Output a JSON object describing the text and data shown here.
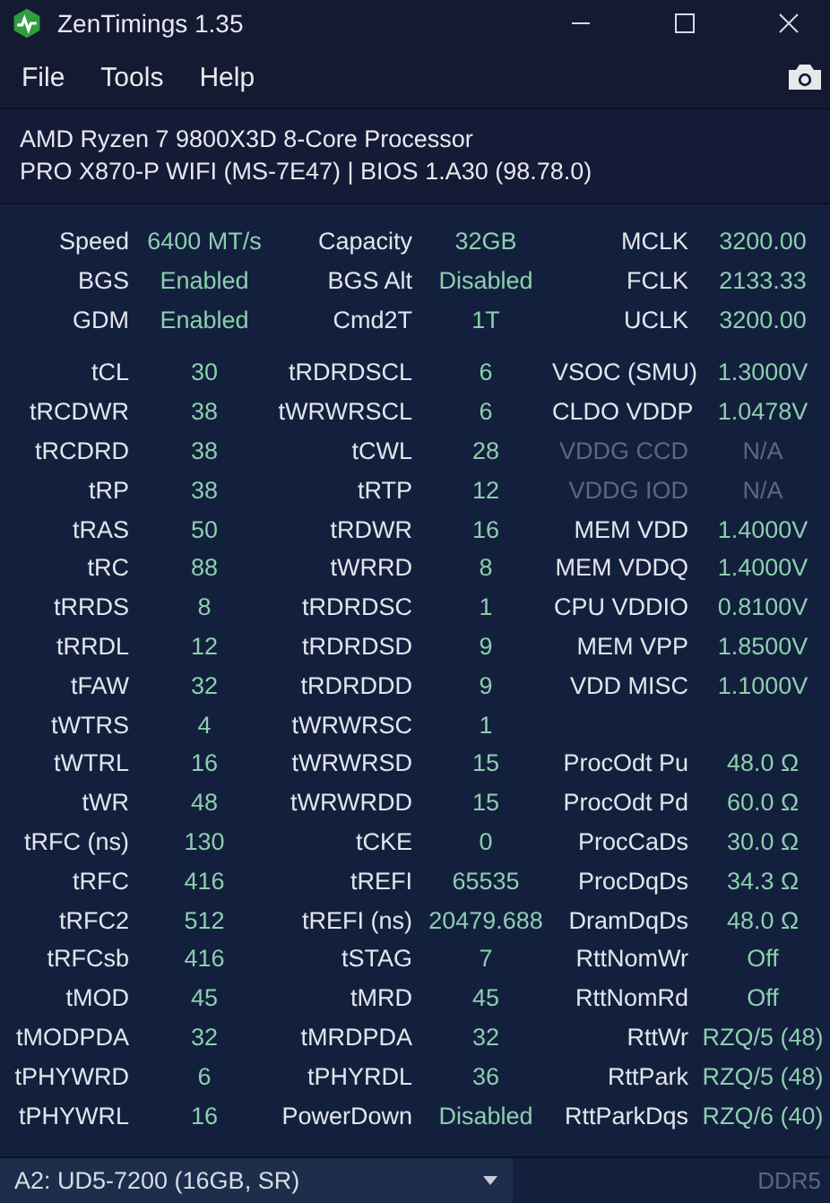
{
  "window": {
    "title": "ZenTimings 1.35"
  },
  "menu": [
    {
      "label": "File"
    },
    {
      "label": "Tools"
    },
    {
      "label": "Help"
    }
  ],
  "system": {
    "processor": "AMD Ryzen 7 9800X3D 8-Core Processor",
    "board": "PRO X870-P WIFI (MS-7E47) | BIOS 1.A30 (98.78.0)"
  },
  "summary": [
    [
      {
        "label": "Speed",
        "value": "6400 MT/s",
        "disabled": false
      },
      {
        "label": "Capacity",
        "value": "32GB",
        "disabled": false
      },
      {
        "label": "MCLK",
        "value": "3200.00",
        "disabled": false
      }
    ],
    [
      {
        "label": "BGS",
        "value": "Enabled",
        "disabled": false
      },
      {
        "label": "BGS Alt",
        "value": "Disabled",
        "disabled": false
      },
      {
        "label": "FCLK",
        "value": "2133.33",
        "disabled": false
      }
    ],
    [
      {
        "label": "GDM",
        "value": "Enabled",
        "disabled": false
      },
      {
        "label": "Cmd2T",
        "value": "1T",
        "disabled": false
      },
      {
        "label": "UCLK",
        "value": "3200.00",
        "disabled": false
      }
    ]
  ],
  "timings": [
    [
      {
        "label": "tCL",
        "value": "30",
        "disabled": false
      },
      {
        "label": "tRDRDSCL",
        "value": "6",
        "disabled": false
      },
      {
        "label": "VSOC (SMU)",
        "value": "1.3000V",
        "disabled": false
      }
    ],
    [
      {
        "label": "tRCDWR",
        "value": "38",
        "disabled": false
      },
      {
        "label": "tWRWRSCL",
        "value": "6",
        "disabled": false
      },
      {
        "label": "CLDO VDDP",
        "value": "1.0478V",
        "disabled": false
      }
    ],
    [
      {
        "label": "tRCDRD",
        "value": "38",
        "disabled": false
      },
      {
        "label": "tCWL",
        "value": "28",
        "disabled": false
      },
      {
        "label": "VDDG CCD",
        "value": "N/A",
        "disabled": true
      }
    ],
    [
      {
        "label": "tRP",
        "value": "38",
        "disabled": false
      },
      {
        "label": "tRTP",
        "value": "12",
        "disabled": false
      },
      {
        "label": "VDDG IOD",
        "value": "N/A",
        "disabled": true
      }
    ],
    [
      {
        "label": "tRAS",
        "value": "50",
        "disabled": false
      },
      {
        "label": "tRDWR",
        "value": "16",
        "disabled": false
      },
      {
        "label": "MEM VDD",
        "value": "1.4000V",
        "disabled": false
      }
    ],
    [
      {
        "label": "tRC",
        "value": "88",
        "disabled": false
      },
      {
        "label": "tWRRD",
        "value": "8",
        "disabled": false
      },
      {
        "label": "MEM VDDQ",
        "value": "1.4000V",
        "disabled": false
      }
    ],
    [
      {
        "label": "tRRDS",
        "value": "8",
        "disabled": false
      },
      {
        "label": "tRDRDSC",
        "value": "1",
        "disabled": false
      },
      {
        "label": "CPU VDDIO",
        "value": "0.8100V",
        "disabled": false
      }
    ],
    [
      {
        "label": "tRRDL",
        "value": "12",
        "disabled": false
      },
      {
        "label": "tRDRDSD",
        "value": "9",
        "disabled": false
      },
      {
        "label": "MEM VPP",
        "value": "1.8500V",
        "disabled": false
      }
    ],
    [
      {
        "label": "tFAW",
        "value": "32",
        "disabled": false
      },
      {
        "label": "tRDRDDD",
        "value": "9",
        "disabled": false
      },
      {
        "label": "VDD MISC",
        "value": "1.1000V",
        "disabled": false
      }
    ],
    [
      {
        "label": "tWTRS",
        "value": "4",
        "disabled": false
      },
      {
        "label": "tWRWRSC",
        "value": "1",
        "disabled": false
      }
    ],
    [
      {
        "label": "tWTRL",
        "value": "16",
        "disabled": false
      },
      {
        "label": "tWRWRSD",
        "value": "15",
        "disabled": false
      },
      {
        "label": "ProcOdt Pu",
        "value": "48.0 Ω",
        "disabled": false
      }
    ],
    [
      {
        "label": "tWR",
        "value": "48",
        "disabled": false
      },
      {
        "label": "tWRWRDD",
        "value": "15",
        "disabled": false
      },
      {
        "label": "ProcOdt Pd",
        "value": "60.0 Ω",
        "disabled": false
      }
    ],
    [
      {
        "label": "tRFC (ns)",
        "value": "130",
        "disabled": false
      },
      {
        "label": "tCKE",
        "value": "0",
        "disabled": false
      },
      {
        "label": "ProcCaDs",
        "value": "30.0 Ω",
        "disabled": false
      }
    ],
    [
      {
        "label": "tRFC",
        "value": "416",
        "disabled": false
      },
      {
        "label": "tREFI",
        "value": "65535",
        "disabled": false
      },
      {
        "label": "ProcDqDs",
        "value": "34.3 Ω",
        "disabled": false
      }
    ],
    [
      {
        "label": "tRFC2",
        "value": "512",
        "disabled": false
      },
      {
        "label": "tREFI (ns)",
        "value": "20479.688",
        "disabled": false
      },
      {
        "label": "DramDqDs",
        "value": "48.0 Ω",
        "disabled": false
      }
    ],
    [
      {
        "label": "tRFCsb",
        "value": "416",
        "disabled": false
      },
      {
        "label": "tSTAG",
        "value": "7",
        "disabled": false
      },
      {
        "label": "RttNomWr",
        "value": "Off",
        "disabled": false
      }
    ],
    [
      {
        "label": "tMOD",
        "value": "45",
        "disabled": false
      },
      {
        "label": "tMRD",
        "value": "45",
        "disabled": false
      },
      {
        "label": "RttNomRd",
        "value": "Off",
        "disabled": false
      }
    ],
    [
      {
        "label": "tMODPDA",
        "value": "32",
        "disabled": false
      },
      {
        "label": "tMRDPDA",
        "value": "32",
        "disabled": false
      },
      {
        "label": "RttWr",
        "value": "RZQ/5 (48)",
        "disabled": false
      }
    ],
    [
      {
        "label": "tPHYWRD",
        "value": "6",
        "disabled": false
      },
      {
        "label": "tPHYRDL",
        "value": "36",
        "disabled": false
      },
      {
        "label": "RttPark",
        "value": "RZQ/5 (48)",
        "disabled": false
      }
    ],
    [
      {
        "label": "tPHYWRL",
        "value": "16",
        "disabled": false
      },
      {
        "label": "PowerDown",
        "value": "Disabled",
        "disabled": false
      },
      {
        "label": "RttParkDqs",
        "value": "RZQ/6 (40)",
        "disabled": false
      }
    ]
  ],
  "footer": {
    "module": "A2: UD5-7200 (16GB, SR)",
    "memory_type": "DDR5"
  }
}
